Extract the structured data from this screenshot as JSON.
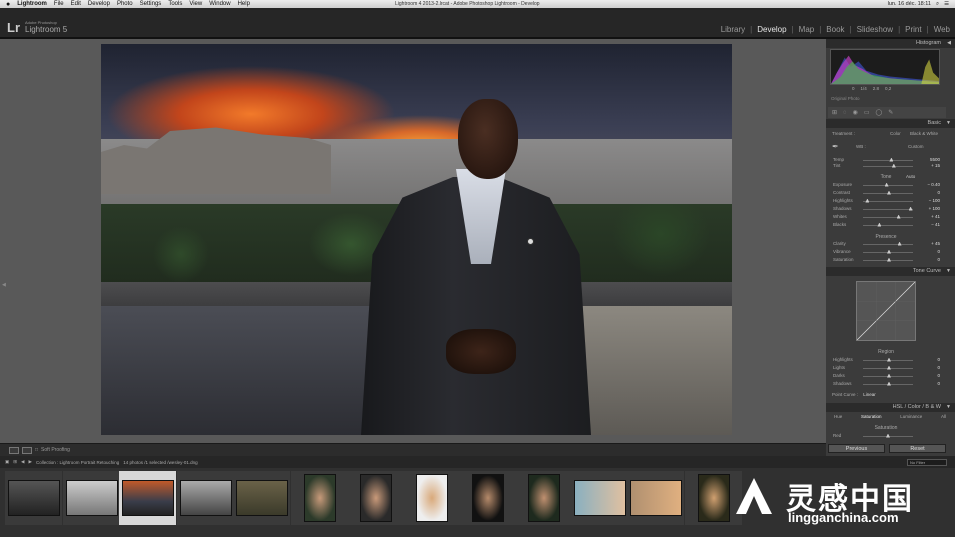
{
  "menubar": {
    "items": [
      "Lightroom",
      "File",
      "Edit",
      "Develop",
      "Photo",
      "Settings",
      "Tools",
      "View",
      "Window",
      "Help"
    ],
    "window_title": "Lightroom 4 2013-2.lrcat - Adobe Photoshop Lightroom - Develop",
    "clock": "lun. 16 déc.  18:11"
  },
  "brand": {
    "logo": "Lr",
    "line1": "Adobe Photoshop",
    "line2": "Lightroom 5"
  },
  "modules": [
    "Library",
    "Develop",
    "Map",
    "Book",
    "Slideshow",
    "Print",
    "Web"
  ],
  "active_module": "Develop",
  "panels": {
    "histogram": "Histogram",
    "histo_values": [
      "0",
      "1/4",
      "2.8",
      "0,2"
    ],
    "original_photo": "Original Photo",
    "basic": "Basic",
    "treatment_label": "Treatment :",
    "treatment_color": "Color",
    "treatment_bw": "Black & White",
    "wb_label": "WB :",
    "wb_value": "Custom",
    "tone": "Tone",
    "tone_auto": "Auto",
    "presence": "Presence",
    "tone_curve": "Tone Curve",
    "region": "Region",
    "point_curve_label": "Point Curve :",
    "point_curve_value": "Linear",
    "hsl": "HSL / Color / B & W",
    "hsl_tabs": [
      "Hue",
      "Saturation",
      "Luminance",
      "All"
    ],
    "saturation": "Saturation",
    "red": "Red"
  },
  "sliders_wb": [
    {
      "label": "Temp",
      "value": "5500",
      "pos": 0.55
    },
    {
      "label": "Tint",
      "value": "+ 15",
      "pos": 0.6
    }
  ],
  "sliders_tone": [
    {
      "label": "Exposure",
      "value": "− 0.40",
      "pos": 0.45
    },
    {
      "label": "Contrast",
      "value": "0",
      "pos": 0.5
    },
    {
      "label": "Highlights",
      "value": "− 100",
      "pos": 0.05
    },
    {
      "label": "Shadows",
      "value": "+ 100",
      "pos": 0.95
    },
    {
      "label": "Whites",
      "value": "+ 41",
      "pos": 0.7
    },
    {
      "label": "Blacks",
      "value": "− 41",
      "pos": 0.3
    }
  ],
  "sliders_presence": [
    {
      "label": "Clarity",
      "value": "+ 45",
      "pos": 0.72
    },
    {
      "label": "Vibrance",
      "value": "0",
      "pos": 0.5
    },
    {
      "label": "Saturation",
      "value": "0",
      "pos": 0.5
    }
  ],
  "sliders_region": [
    {
      "label": "Highlights",
      "value": "0",
      "pos": 0.5
    },
    {
      "label": "Lights",
      "value": "0",
      "pos": 0.5
    },
    {
      "label": "Darks",
      "value": "0",
      "pos": 0.5
    },
    {
      "label": "Shadows",
      "value": "0",
      "pos": 0.5
    }
  ],
  "toolbar": {
    "soft_proofing": "Soft Proofing"
  },
  "buttons": {
    "previous": "Previous",
    "reset": "Reset"
  },
  "filmbar": {
    "collection": "Collection : Lightroom Portrait Retouching",
    "count": "14 photos /1 selected /wesley-01.dng",
    "filter_label": "Filter :",
    "filter_value": "No Filter"
  },
  "watermark": {
    "cn": "灵感中国",
    "en": "lingganchina.com"
  }
}
